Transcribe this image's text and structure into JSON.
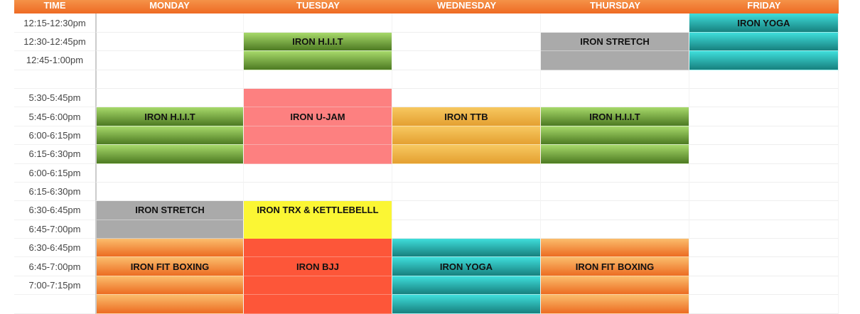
{
  "header": [
    "TIME",
    "MONDAY",
    "TUESDAY",
    "WEDNESDAY",
    "THURSDAY",
    "FRIDAY"
  ],
  "rows": [
    {
      "time": "12:15-12:30pm",
      "cells": [
        [
          "",
          ""
        ],
        [
          "",
          ""
        ],
        [
          "",
          ""
        ],
        [
          "",
          ""
        ],
        [
          "yoga",
          "IRON YOGA"
        ]
      ]
    },
    {
      "time": "12:30-12:45pm",
      "cells": [
        [
          "",
          ""
        ],
        [
          "hiit",
          "IRON H.I.I.T"
        ],
        [
          "",
          ""
        ],
        [
          "stretch",
          "IRON STRETCH"
        ],
        [
          "yoga",
          ""
        ]
      ]
    },
    {
      "time": "12:45-1:00pm",
      "cells": [
        [
          "",
          ""
        ],
        [
          "hiit",
          ""
        ],
        [
          "",
          ""
        ],
        [
          "stretch",
          ""
        ],
        [
          "yoga",
          ""
        ]
      ]
    },
    {
      "time": "",
      "cells": [
        [
          "",
          ""
        ],
        [
          "",
          ""
        ],
        [
          "",
          ""
        ],
        [
          "",
          ""
        ],
        [
          "",
          ""
        ]
      ]
    },
    {
      "time": "5:30-5:45pm",
      "cells": [
        [
          "",
          ""
        ],
        [
          "ujam",
          ""
        ],
        [
          "",
          ""
        ],
        [
          "",
          ""
        ],
        [
          "",
          ""
        ]
      ]
    },
    {
      "time": "5:45-6:00pm",
      "cells": [
        [
          "hiit",
          "IRON H.I.I.T"
        ],
        [
          "ujam",
          "IRON U-JAM"
        ],
        [
          "ttb",
          "IRON TTB"
        ],
        [
          "hiit",
          "IRON H.I.I.T"
        ],
        [
          "",
          ""
        ]
      ]
    },
    {
      "time": "6:00-6:15pm",
      "cells": [
        [
          "hiit",
          ""
        ],
        [
          "ujam",
          ""
        ],
        [
          "ttb",
          ""
        ],
        [
          "hiit",
          ""
        ],
        [
          "",
          ""
        ]
      ]
    },
    {
      "time": "6:15-6:30pm",
      "cells": [
        [
          "hiit",
          ""
        ],
        [
          "ujam",
          ""
        ],
        [
          "ttb",
          ""
        ],
        [
          "hiit",
          ""
        ],
        [
          "",
          ""
        ]
      ]
    },
    {
      "time": "6:00-6:15pm",
      "cells": [
        [
          "",
          ""
        ],
        [
          "",
          ""
        ],
        [
          "",
          ""
        ],
        [
          "",
          ""
        ],
        [
          "",
          ""
        ]
      ]
    },
    {
      "time": "6:15-6:30pm",
      "cells": [
        [
          "",
          ""
        ],
        [
          "",
          ""
        ],
        [
          "",
          ""
        ],
        [
          "",
          ""
        ],
        [
          "",
          ""
        ]
      ]
    },
    {
      "time": "6:30-6:45pm",
      "cells": [
        [
          "stretch",
          "IRON STRETCH"
        ],
        [
          "trx",
          "IRON TRX & KETTLEBELLL"
        ],
        [
          "",
          ""
        ],
        [
          "",
          ""
        ],
        [
          "",
          ""
        ]
      ]
    },
    {
      "time": "6:45-7:00pm",
      "cells": [
        [
          "stretch",
          ""
        ],
        [
          "trx",
          ""
        ],
        [
          "",
          ""
        ],
        [
          "",
          ""
        ],
        [
          "",
          ""
        ]
      ]
    },
    {
      "time": "6:30-6:45pm",
      "cells": [
        [
          "boxing",
          ""
        ],
        [
          "bjj",
          ""
        ],
        [
          "yoga",
          ""
        ],
        [
          "boxing",
          ""
        ],
        [
          "",
          ""
        ]
      ]
    },
    {
      "time": "6:45-7:00pm",
      "cells": [
        [
          "boxing",
          "IRON FIT BOXING"
        ],
        [
          "bjj",
          "IRON BJJ"
        ],
        [
          "yoga",
          "IRON YOGA"
        ],
        [
          "boxing",
          "IRON FIT BOXING"
        ],
        [
          "",
          ""
        ]
      ]
    },
    {
      "time": "7:00-7:15pm",
      "cells": [
        [
          "boxing",
          ""
        ],
        [
          "bjj",
          ""
        ],
        [
          "yoga",
          ""
        ],
        [
          "boxing",
          ""
        ],
        [
          "",
          ""
        ]
      ]
    },
    {
      "time": "",
      "cells": [
        [
          "boxing",
          ""
        ],
        [
          "bjj",
          ""
        ],
        [
          "yoga",
          ""
        ],
        [
          "boxing",
          ""
        ],
        [
          "",
          ""
        ]
      ]
    }
  ]
}
